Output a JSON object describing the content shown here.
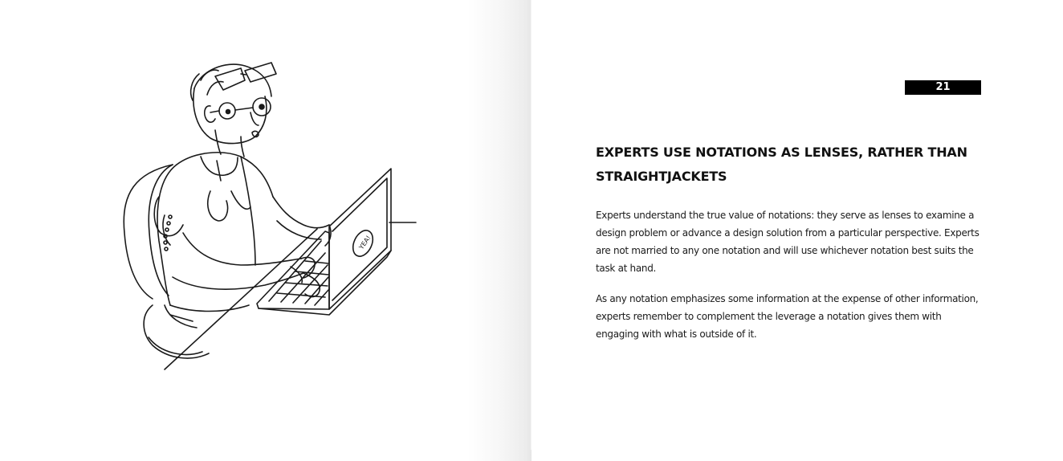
{
  "page": {
    "number": "21"
  },
  "article": {
    "heading": "EXPERTS USE NOTATIONS AS LENSES, RATHER THAN STRAIGHTJACKETS",
    "paragraphs": [
      "Experts understand the true value of notations: they serve as lenses to examine a design problem or advance a design solution from a particular perspective. Experts are not married to any one notation and will use whichever notation best suits the task at hand.",
      "As any notation emphasizes some information at the expense of other information, experts remember to complement the leverage a notation gives them with engaging with what is outside of it."
    ]
  },
  "illustration": {
    "subject": "person-with-glasses-typing-on-laptop",
    "laptop_sticker": "YEA!"
  },
  "colors": {
    "ink": "#111111",
    "page_number_bg": "#000000",
    "page_number_fg": "#ffffff"
  }
}
